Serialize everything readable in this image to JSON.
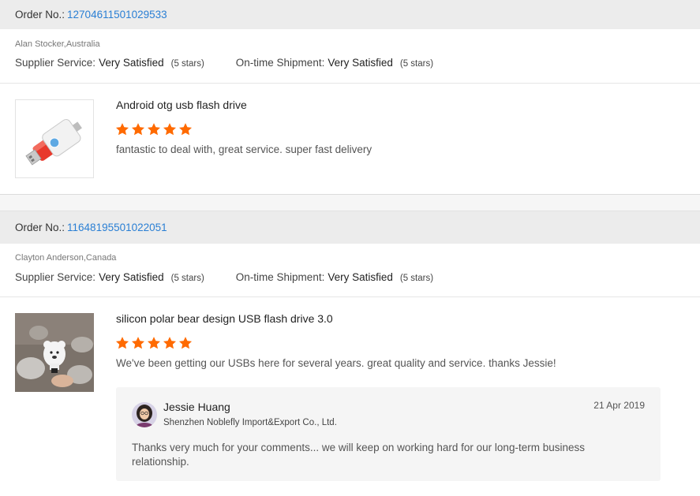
{
  "orders": [
    {
      "order_label": "Order No.:",
      "order_number": "12704611501029533",
      "buyer": "Alan Stocker,Australia",
      "supplier_service_label": "Supplier Service:",
      "supplier_service_value": "Very Satisfied",
      "supplier_service_stars": "(5 stars)",
      "shipment_label": "On-time Shipment:",
      "shipment_value": "Very Satisfied",
      "shipment_stars": "(5 stars)",
      "product_title": "Android otg usb flash drive",
      "rating": 5,
      "review": "fantastic to deal with, great service. super fast delivery",
      "thumb_icon": "red-usb-flash-drive-image"
    },
    {
      "order_label": "Order No.:",
      "order_number": "11648195501022051",
      "buyer": "Clayton Anderson,Canada",
      "supplier_service_label": "Supplier Service:",
      "supplier_service_value": "Very Satisfied",
      "supplier_service_stars": "(5 stars)",
      "shipment_label": "On-time Shipment:",
      "shipment_value": "Very Satisfied",
      "shipment_stars": "(5 stars)",
      "product_title": "silicon polar bear design USB flash drive 3.0",
      "rating": 5,
      "review": "We've been getting our USBs here for several years. great quality and service. thanks Jessie!",
      "thumb_icon": "polar-bear-usb-image",
      "reply": {
        "name": "Jessie Huang",
        "company": "Shenzhen Noblefly Import&Export Co., Ltd.",
        "date": "21 Apr 2019",
        "text": "Thanks very much for your comments... we will keep on working hard for our long-term business relationship."
      }
    }
  ],
  "colors": {
    "link": "#2a7fd4",
    "star": "#ff6a00",
    "header_bg": "#ececec"
  }
}
